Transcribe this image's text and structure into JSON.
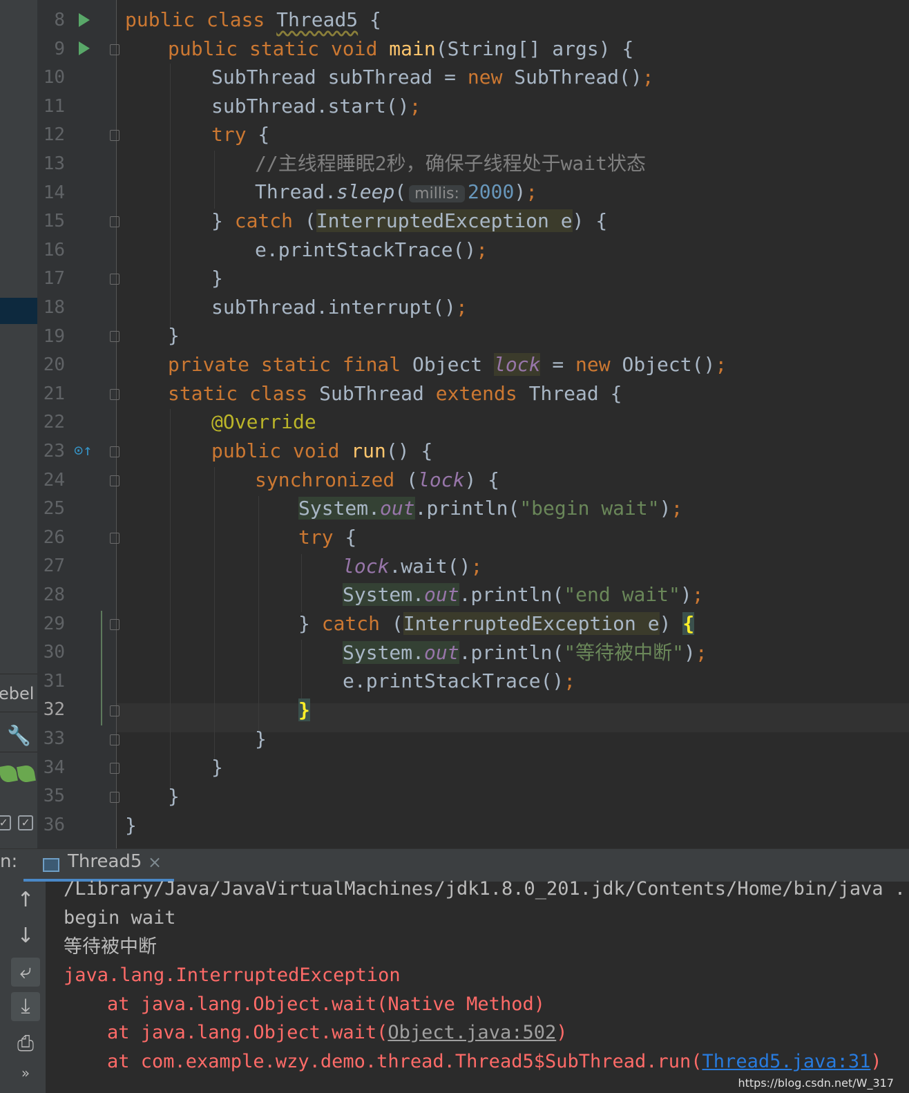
{
  "left_strip": {
    "rebel_label": "ebel",
    "icons": [
      "wrench-icon",
      "jrebel-leaf-icon",
      "jrebel-cloud-icon",
      "checkbox-icon",
      "checkbox-icon"
    ]
  },
  "editor": {
    "file_class": "Thread5",
    "current_line": 32,
    "lines": [
      {
        "n": 8
      },
      {
        "n": 9
      },
      {
        "n": 10
      },
      {
        "n": 11
      },
      {
        "n": 12
      },
      {
        "n": 13
      },
      {
        "n": 14
      },
      {
        "n": 15
      },
      {
        "n": 16
      },
      {
        "n": 17
      },
      {
        "n": 18
      },
      {
        "n": 19
      },
      {
        "n": 20
      },
      {
        "n": 21
      },
      {
        "n": 22
      },
      {
        "n": 23
      },
      {
        "n": 24
      },
      {
        "n": 25
      },
      {
        "n": 26
      },
      {
        "n": 27
      },
      {
        "n": 28
      },
      {
        "n": 29
      },
      {
        "n": 30
      },
      {
        "n": 31
      },
      {
        "n": 32
      },
      {
        "n": 33
      },
      {
        "n": 34
      },
      {
        "n": 35
      },
      {
        "n": 36
      }
    ],
    "code": {
      "l8": {
        "a": "public class ",
        "b": "Thread5",
        "c": " {"
      },
      "l9": {
        "a": "public static void ",
        "b": "main",
        "c": "(String[] args) {"
      },
      "l10": {
        "a": "SubThread subThread = ",
        "b": "new",
        "c": " SubThread()",
        "d": ";"
      },
      "l11": {
        "a": "subThread.start()",
        "b": ";"
      },
      "l12": {
        "a": "try",
        "b": " {"
      },
      "l13": {
        "a": "//主线程睡眠2秒，确保子线程处于wait状态"
      },
      "l14": {
        "a": "Thread.",
        "b": "sleep",
        "c": "(",
        "hint": "millis:",
        "num": "2000",
        "d": ")",
        "e": ";"
      },
      "l15": {
        "a": "} ",
        "b": "catch",
        "c": " (",
        "d": "InterruptedException e",
        "e": ") {"
      },
      "l16": {
        "a": "e.printStackTrace()",
        "b": ";"
      },
      "l17": {
        "a": "}"
      },
      "l18": {
        "a": "subThread.interrupt()",
        "b": ";"
      },
      "l19": {
        "a": "}"
      },
      "l20": {
        "a": "private static final ",
        "b": "Object ",
        "c": "lock",
        "d": " = ",
        "e": "new",
        "f": " Object()",
        "g": ";"
      },
      "l21": {
        "a": "static class ",
        "b": "SubThread ",
        "c": "extends",
        "d": " Thread {"
      },
      "l22": {
        "a": "@Override"
      },
      "l23": {
        "a": "public void ",
        "b": "run",
        "c": "() {"
      },
      "l24": {
        "a": "synchronized",
        "b": " (",
        "c": "lock",
        "d": ") {"
      },
      "l25": {
        "a": "System.",
        "b": "out",
        "c": ".println(",
        "d": "\"begin wait\"",
        "e": ")",
        "f": ";"
      },
      "l26": {
        "a": "try",
        "b": " {"
      },
      "l27": {
        "a": "lock",
        "b": ".wait()",
        "c": ";"
      },
      "l28": {
        "a": "System.",
        "b": "out",
        "c": ".println(",
        "d": "\"end wait\"",
        "e": ")",
        "f": ";"
      },
      "l29": {
        "a": "} ",
        "b": "catch",
        "c": " (",
        "d": "InterruptedException e",
        "e": ") ",
        "f": "{"
      },
      "l30": {
        "a": "System.",
        "b": "out",
        "c": ".println(",
        "d": "\"等待被中断\"",
        "e": ")",
        "f": ";"
      },
      "l31": {
        "a": "e.printStackTrace()",
        "b": ";"
      },
      "l32": {
        "a": "}"
      },
      "l33": {
        "a": "}"
      },
      "l34": {
        "a": "}"
      },
      "l35": {
        "a": "}"
      },
      "l36": {
        "a": "}"
      }
    }
  },
  "run_window": {
    "label": "n:",
    "tab_label": "Thread5",
    "tab_close": "×",
    "side_buttons": [
      "up-arrow-icon",
      "down-arrow-icon",
      "soft-wrap-icon",
      "scroll-to-end-icon",
      "print-icon",
      "more-icon"
    ],
    "console": {
      "cmd": "/Library/Java/JavaVirtualMachines/jdk1.8.0_201.jdk/Contents/Home/bin/java ...",
      "out1": "begin wait",
      "out2": "等待被中断",
      "exc": "java.lang.InterruptedException",
      "trace1": "at java.lang.Object.wait(Native Method)",
      "trace2_pre": "at java.lang.Object.wait(",
      "trace2_link": "Object.java:502",
      "trace2_post": ")",
      "trace3_pre": "at com.example.wzy.demo.thread.Thread5$SubThread.run(",
      "trace3_link": "Thread5.java:31",
      "trace3_post": ")"
    }
  },
  "watermark": "https://blog.csdn.net/W_317",
  "colors": {
    "background": "#2b2b2b",
    "keyword": "#cc7832",
    "string": "#6a8759",
    "number": "#6897bb",
    "error": "#ff6b68",
    "link": "#287bde"
  }
}
